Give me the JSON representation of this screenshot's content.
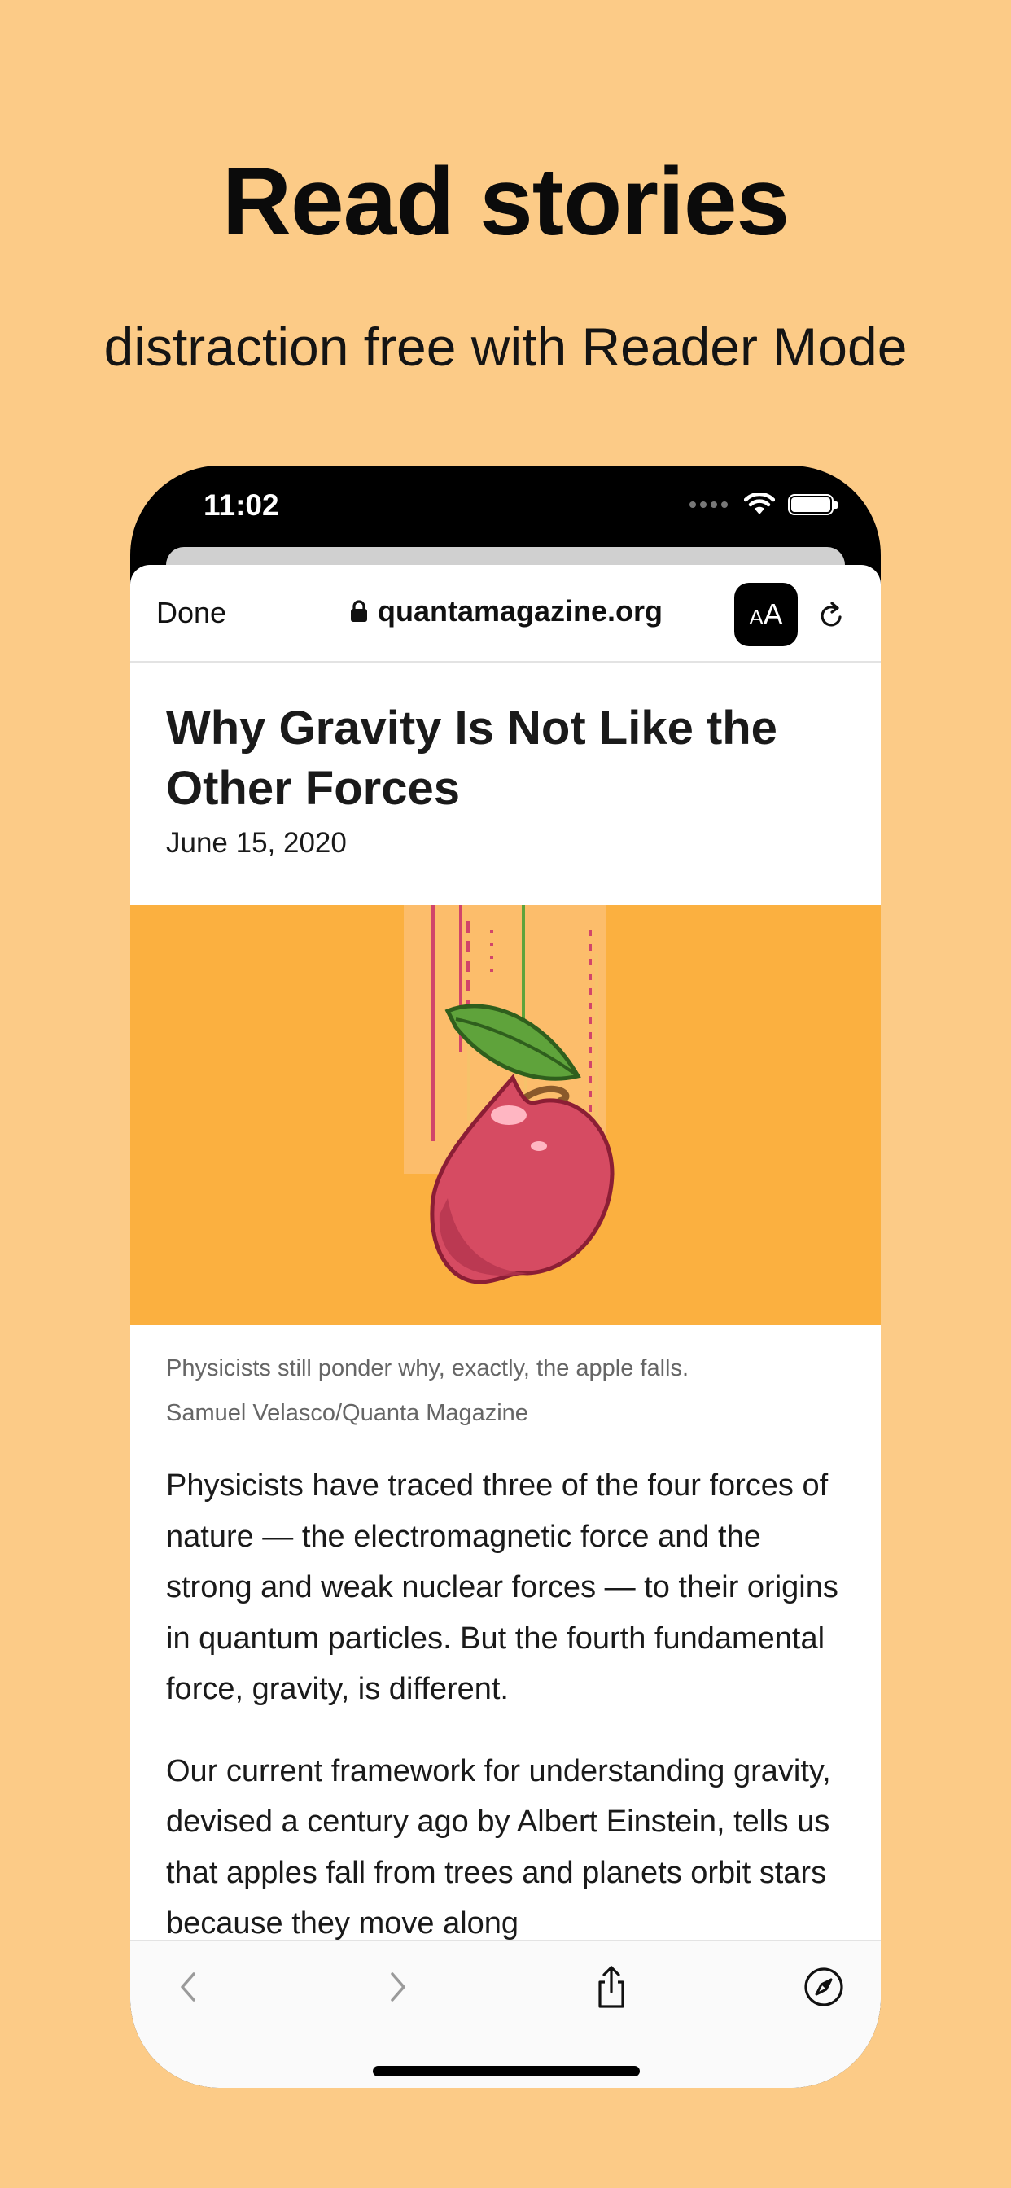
{
  "promo": {
    "headline": "Read stories",
    "subheadline": "distraction free with Reader Mode",
    "background_color": "#fccb87"
  },
  "status_bar": {
    "time": "11:02",
    "icons": [
      "cellular-signal-icon",
      "wifi-icon",
      "battery-icon"
    ]
  },
  "browser": {
    "done_label": "Done",
    "url": "quantamagazine.org",
    "reader_button_label": "AA",
    "icons": [
      "lock-icon",
      "reload-icon"
    ]
  },
  "article": {
    "title": "Why Gravity Is Not Like the Other Forces",
    "date": "June 15, 2020",
    "hero_image": "apple-falling-illustration",
    "hero_background": "#fbb040",
    "caption": "Physicists still ponder why, exactly, the apple falls.",
    "credit": "Samuel Velasco/Quanta Magazine",
    "paragraphs": [
      "Physicists have traced three of the four forces of nature — the electromagnetic force and the strong and weak nuclear forces — to their origins in quantum particles. But the fourth fundamental force, gravity, is different.",
      "Our current framework for understanding gravity, devised a century ago by Albert Einstein, tells us that apples fall from trees and planets orbit stars because they move along"
    ]
  },
  "toolbar": {
    "icons": [
      "back-chevron-icon",
      "forward-chevron-icon",
      "share-icon",
      "compass-icon"
    ]
  }
}
